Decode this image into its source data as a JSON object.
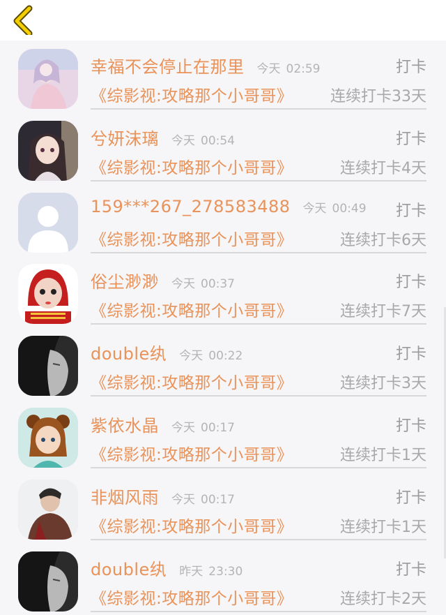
{
  "header": {
    "back_icon": "chevron-left-icon",
    "accent": "#e9c400"
  },
  "colors": {
    "name_color": "#e9935a",
    "time_color": "#b4b4b4",
    "action_color": "#9b9b9b"
  },
  "entries": [
    {
      "name": "幸福不会停止在那里",
      "day": "今天",
      "time": "02:59",
      "action": "打卡",
      "book": "《综影视:攻略那个小哥哥》",
      "streak": "连续打卡33天",
      "avatar": "avatar-girl-pink-dress"
    },
    {
      "name": "兮妍沫璃",
      "day": "今天",
      "time": "00:54",
      "action": "打卡",
      "book": "《综影视:攻略那个小哥哥》",
      "streak": "连续打卡4天",
      "avatar": "avatar-anime-girl"
    },
    {
      "name": "159***267_278583488",
      "day": "今天",
      "time": "00:49",
      "action": "打卡",
      "book": "《综影视:攻略那个小哥哥》",
      "streak": "连续打卡6天",
      "avatar": "default-user-icon"
    },
    {
      "name": "俗尘渺渺",
      "day": "今天",
      "time": "00:37",
      "action": "打卡",
      "book": "《综影视:攻略那个小哥哥》",
      "streak": "连续打卡7天",
      "avatar": "avatar-red-hood-girl"
    },
    {
      "name": "double纨",
      "day": "今天",
      "time": "00:22",
      "action": "打卡",
      "book": "《综影视:攻略那个小哥哥》",
      "streak": "连续打卡3天",
      "avatar": "avatar-dark-portrait"
    },
    {
      "name": "紫依水晶",
      "day": "今天",
      "time": "00:17",
      "action": "打卡",
      "book": "《综影视:攻略那个小哥哥》",
      "streak": "连续打卡1天",
      "avatar": "avatar-cartoon-girl"
    },
    {
      "name": "非烟风雨",
      "day": "今天",
      "time": "00:17",
      "action": "打卡",
      "book": "《综影视:攻略那个小哥哥》",
      "streak": "连续打卡1天",
      "avatar": "avatar-man-jacket"
    },
    {
      "name": "double纨",
      "day": "昨天",
      "time": "23:30",
      "action": "打卡",
      "book": "《综影视:攻略那个小哥哥》",
      "streak": "连续打卡2天",
      "avatar": "avatar-dark-portrait"
    }
  ]
}
